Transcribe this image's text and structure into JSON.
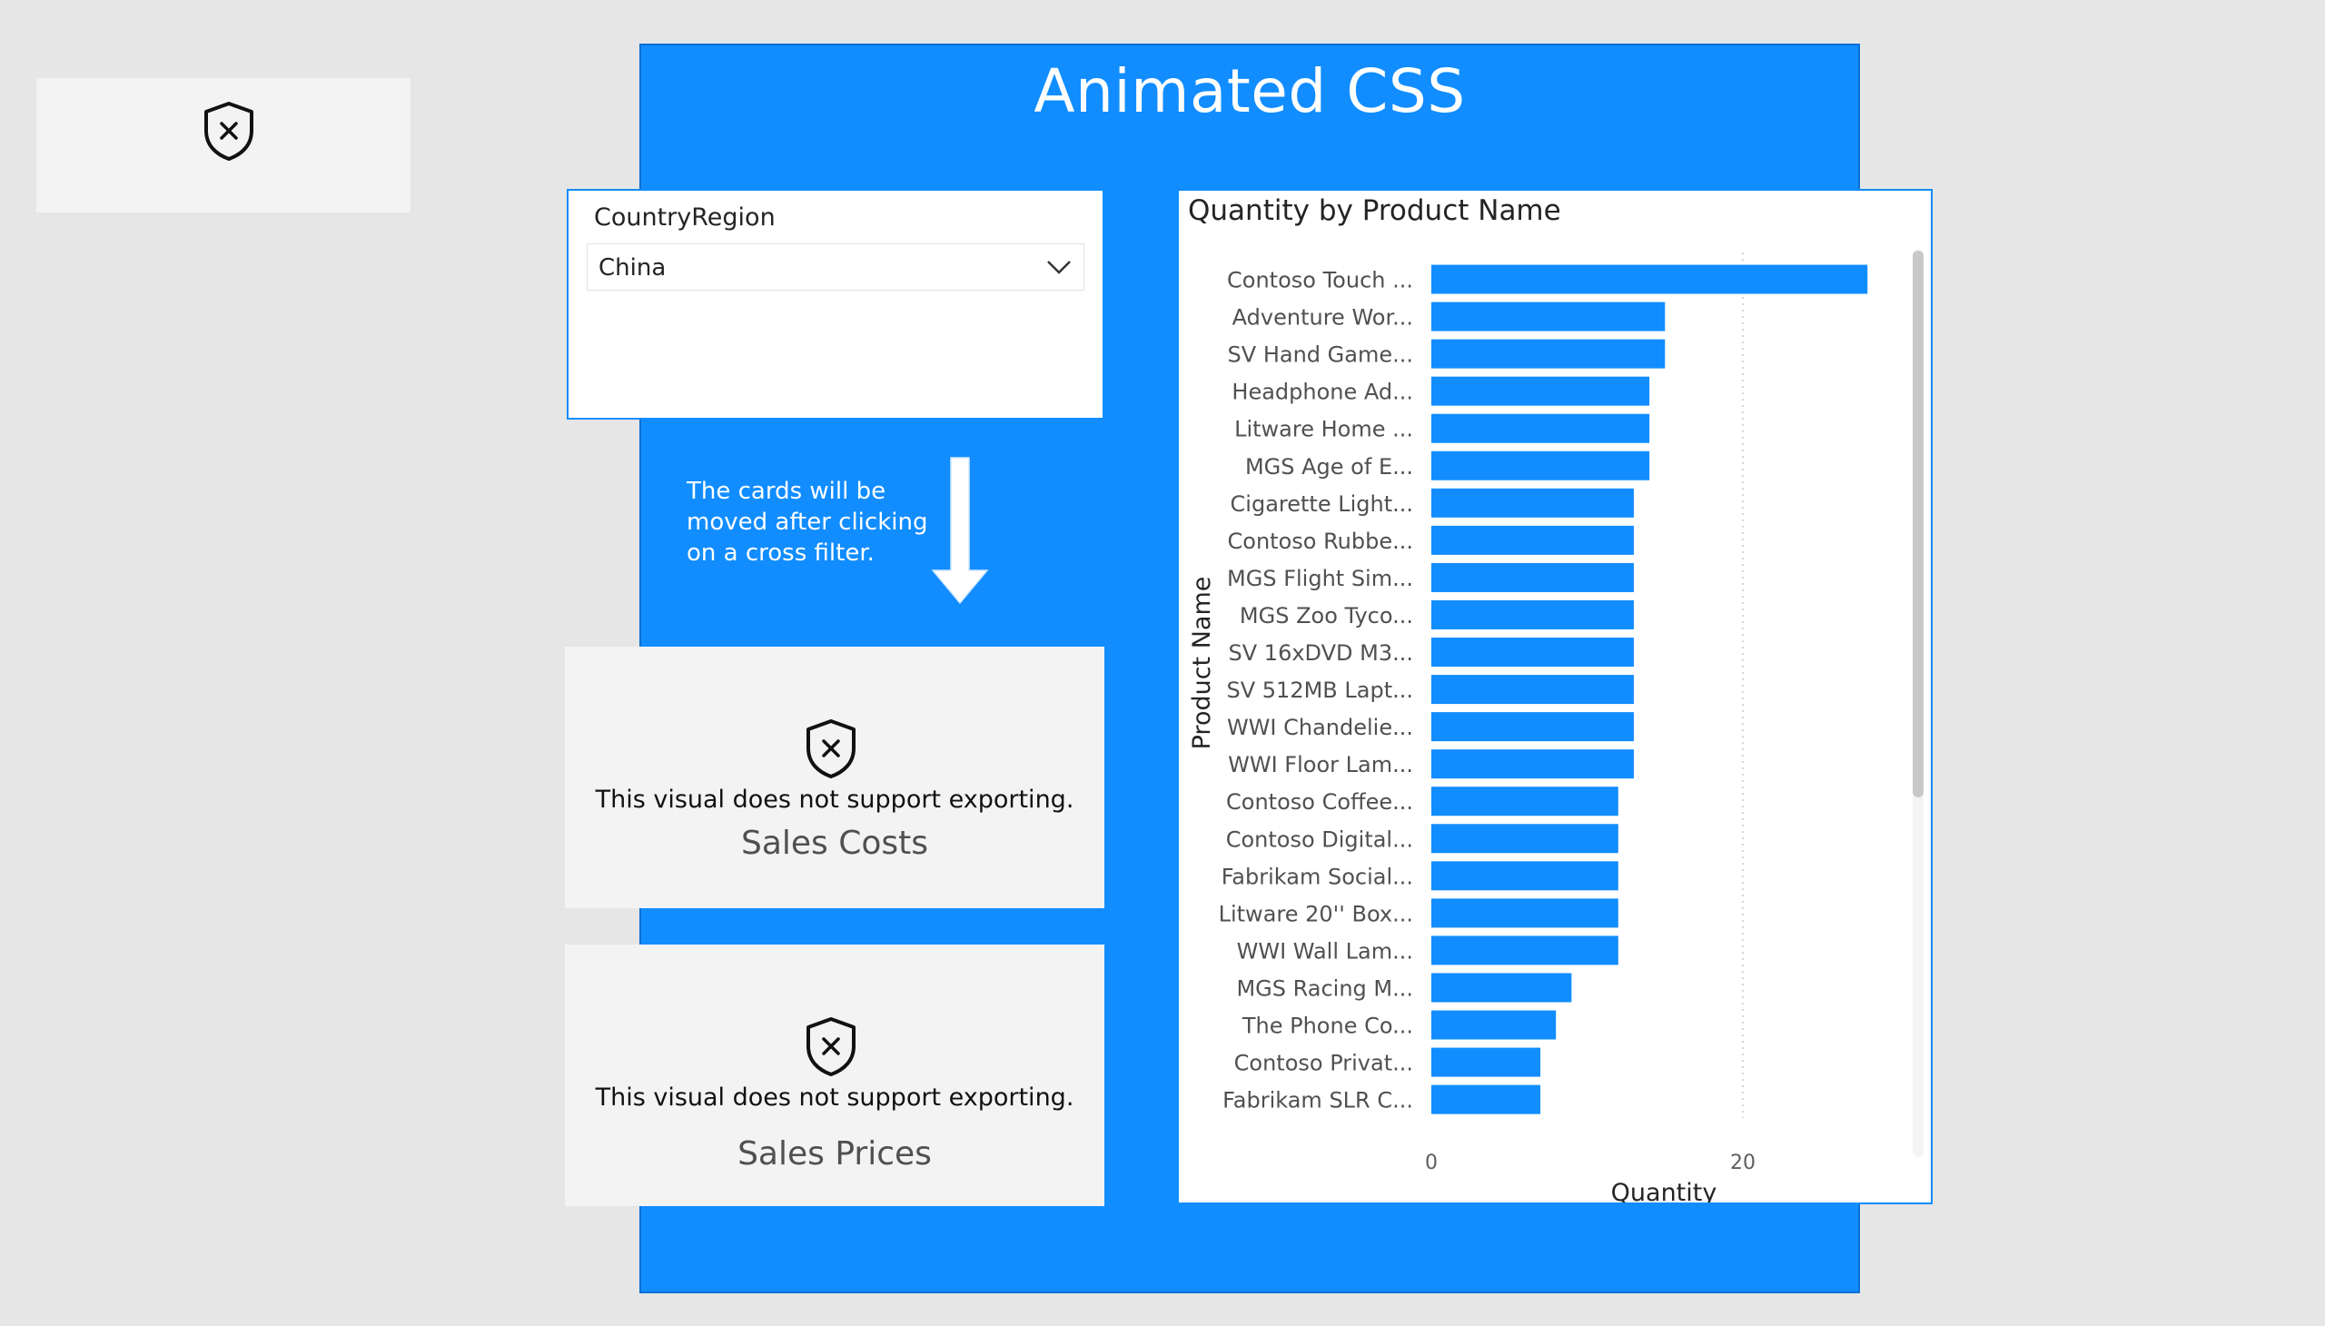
{
  "page": {
    "title": "Animated CSS"
  },
  "slicer": {
    "title": "CountryRegion",
    "selected": "China"
  },
  "note": {
    "lines": [
      "The cards will be",
      "moved after clicking",
      "on a cross filter."
    ]
  },
  "cards": {
    "costs": {
      "message": "This visual does not support exporting.",
      "caption": "Sales Costs"
    },
    "prices": {
      "message": "This visual does not support exporting.",
      "caption": "Sales Prices"
    }
  },
  "icons": {
    "blocked": "shield-x-icon",
    "dropdown": "chevron-down-icon",
    "arrow": "arrow-down-icon"
  },
  "colors": {
    "accent": "#118dff",
    "panel": "#f3f3f3",
    "background": "#e6e6e6"
  },
  "chart_data": {
    "type": "bar",
    "orientation": "horizontal",
    "title": "Quantity by Product Name",
    "xlabel": "Quantity",
    "ylabel": "Product Name",
    "xlim": [
      0,
      30
    ],
    "x_ticks": [
      "0",
      "20"
    ],
    "grid": "vertical dotted at 20",
    "categories": [
      "Contoso Touch ...",
      "Adventure Wor...",
      "SV Hand Game...",
      "Headphone Ad...",
      "Litware Home ...",
      "MGS Age of E...",
      "Cigarette Light...",
      "Contoso Rubbe...",
      "MGS Flight Sim...",
      "MGS Zoo Tyco...",
      "SV 16xDVD M3...",
      "SV 512MB Lapt...",
      "WWI Chandelie...",
      "WWI Floor Lam...",
      "Contoso Coffee...",
      "Contoso Digital...",
      "Fabrikam Social...",
      "Litware 20'' Box...",
      "WWI Wall Lam...",
      "MGS Racing M...",
      "The Phone Co...",
      "Contoso Privat...",
      "Fabrikam SLR C..."
    ],
    "values": [
      28,
      15,
      15,
      14,
      14,
      14,
      13,
      13,
      13,
      13,
      13,
      13,
      13,
      13,
      12,
      12,
      12,
      12,
      12,
      9,
      8,
      7,
      7
    ]
  }
}
